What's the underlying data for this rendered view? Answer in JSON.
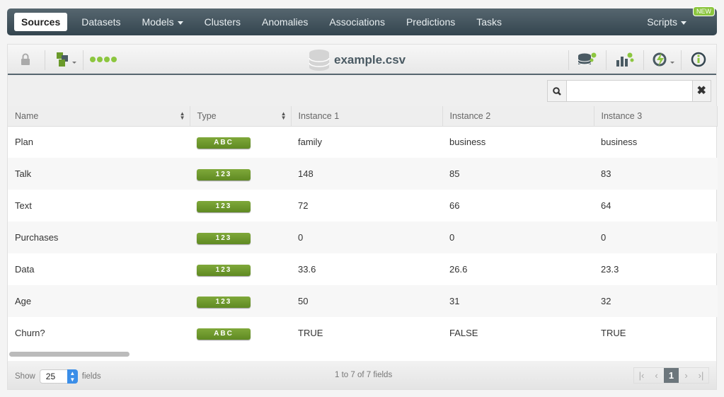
{
  "nav": {
    "items": [
      "Sources",
      "Datasets",
      "Models",
      "Clusters",
      "Anomalies",
      "Associations",
      "Predictions",
      "Tasks"
    ],
    "scripts": "Scripts",
    "new_badge": "NEW"
  },
  "toolbar": {
    "title": "example.csv",
    "progress_dots": 4,
    "accent": "#8cc63f"
  },
  "search": {
    "value": "",
    "placeholder": ""
  },
  "table": {
    "columns": [
      "Name",
      "Type",
      "Instance 1",
      "Instance 2",
      "Instance 3"
    ],
    "rows": [
      {
        "name": "Plan",
        "type": "ABC",
        "v": [
          "family",
          "business",
          "business"
        ]
      },
      {
        "name": "Talk",
        "type": "123",
        "v": [
          "148",
          "85",
          "83"
        ]
      },
      {
        "name": "Text",
        "type": "123",
        "v": [
          "72",
          "66",
          "64"
        ]
      },
      {
        "name": "Purchases",
        "type": "123",
        "v": [
          "0",
          "0",
          "0"
        ]
      },
      {
        "name": "Data",
        "type": "123",
        "v": [
          "33.6",
          "26.6",
          "23.3"
        ]
      },
      {
        "name": "Age",
        "type": "123",
        "v": [
          "50",
          "31",
          "32"
        ]
      },
      {
        "name": "Churn?",
        "type": "ABC",
        "v": [
          "TRUE",
          "FALSE",
          "TRUE"
        ]
      }
    ]
  },
  "footer": {
    "show": "Show",
    "page_size": "25",
    "fields": "fields",
    "count": "1 to 7 of 7 fields",
    "page": "1"
  }
}
